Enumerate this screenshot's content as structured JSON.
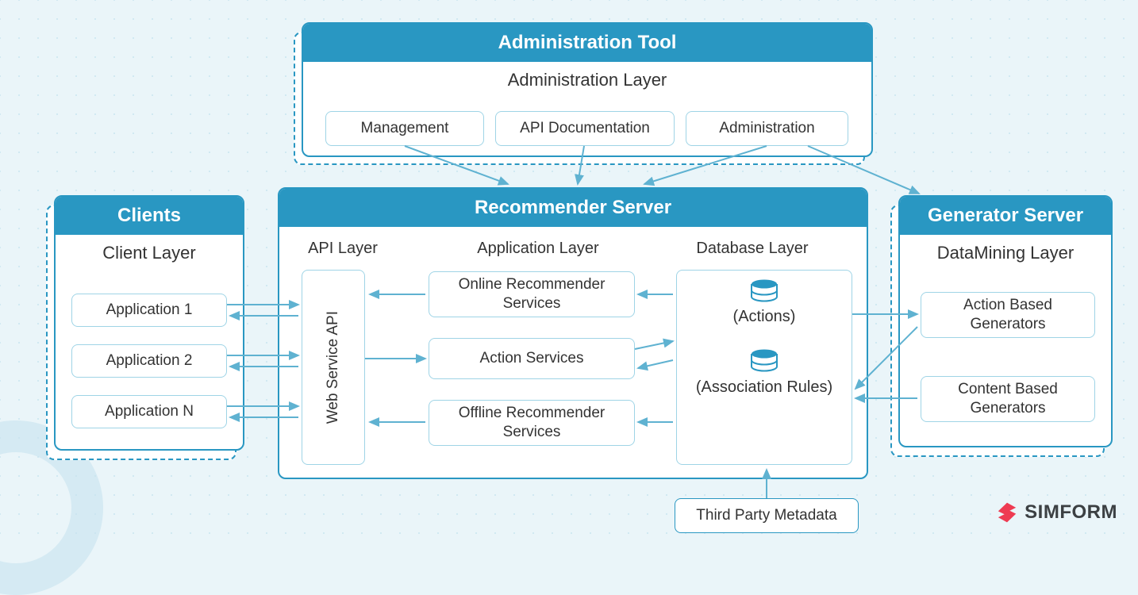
{
  "admin": {
    "header": "Administration Tool",
    "subtitle": "Administration Layer",
    "items": [
      "Management",
      "API Documentation",
      "Administration"
    ]
  },
  "clients": {
    "header": "Clients",
    "subtitle": "Client Layer",
    "items": [
      "Application 1",
      "Application 2",
      "Application N"
    ]
  },
  "recommender": {
    "header": "Recommender Server",
    "api_layer_title": "API Layer",
    "app_layer_title": "Application Layer",
    "db_layer_title": "Database Layer",
    "api_box": "Web Service API",
    "app_boxes": [
      "Online Recommender Services",
      "Action Services",
      "Offline Recommender Services"
    ],
    "db_labels": [
      "(Actions)",
      "(Association Rules)"
    ]
  },
  "generator": {
    "header": "Generator Server",
    "subtitle": "DataMining Layer",
    "items": [
      "Action Based Generators",
      "Content Based Generators"
    ]
  },
  "third_party": "Third Party Metadata",
  "brand": "SIMFORM",
  "colors": {
    "accent": "#2997c2",
    "brand": "#ee3b52",
    "bg": "#eaf5f9"
  }
}
